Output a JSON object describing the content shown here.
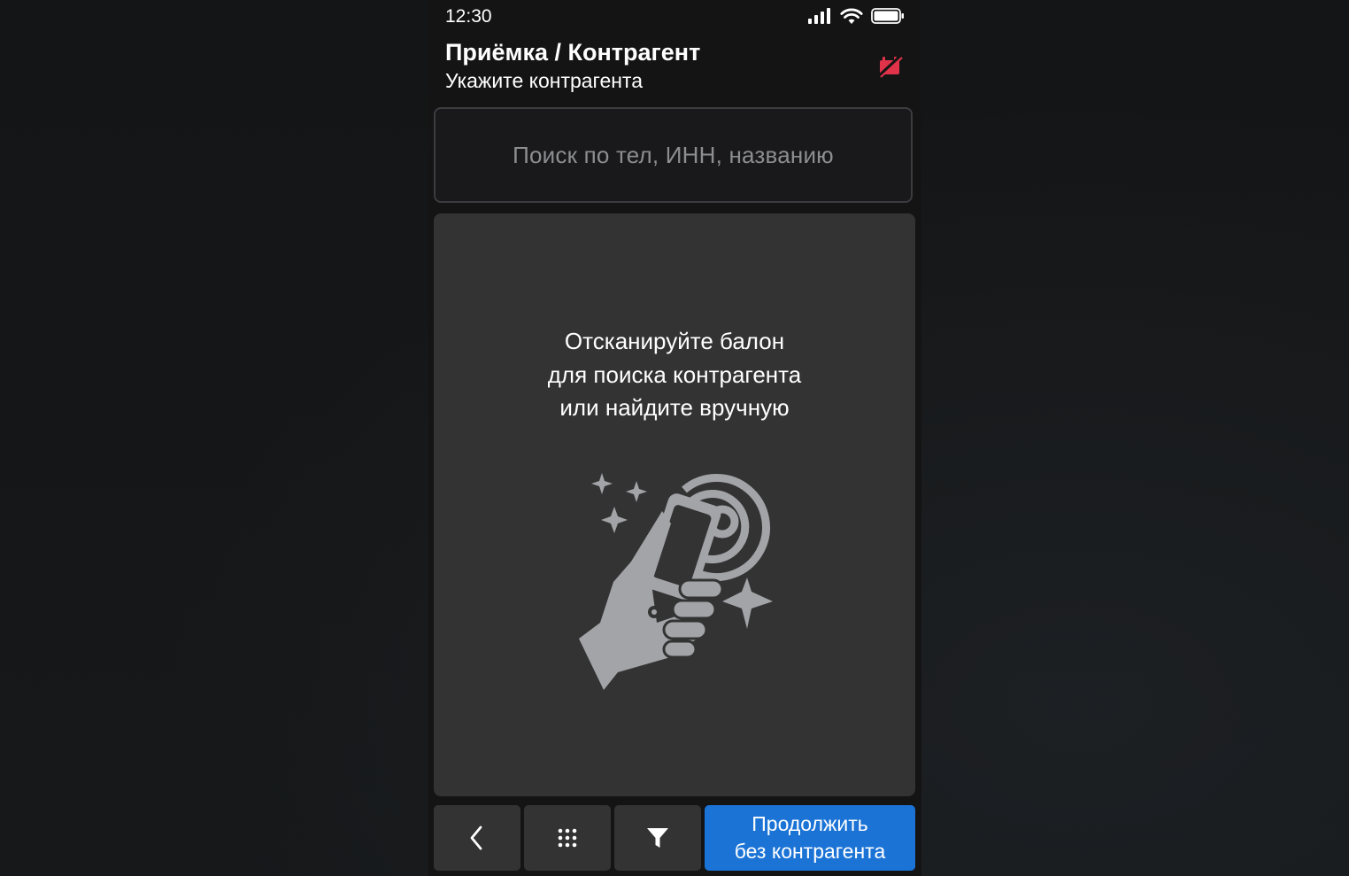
{
  "status_bar": {
    "time": "12:30",
    "icons": [
      "signal-icon",
      "wifi-icon",
      "battery-icon"
    ]
  },
  "header": {
    "title": "Приёмка / Контрагент",
    "subtitle": "Укажите контрагента",
    "status_icon": "offline-sync-icon",
    "status_icon_color": "#e0334a"
  },
  "search": {
    "placeholder": "Поиск по тел, ИНН, названию"
  },
  "scan_panel": {
    "line1": "Отсканируйте балон",
    "line2": "для поиска контрагента",
    "line3": "или найдите вручную",
    "illustration": "hand-phone-nfc-scan-icon"
  },
  "bottom_bar": {
    "back_icon": "chevron-left-icon",
    "keypad_icon": "keypad-grid-icon",
    "filter_icon": "filter-icon",
    "continue_line1": "Продолжить",
    "continue_line2": "без контрагента",
    "accent": "#1b73d6"
  }
}
